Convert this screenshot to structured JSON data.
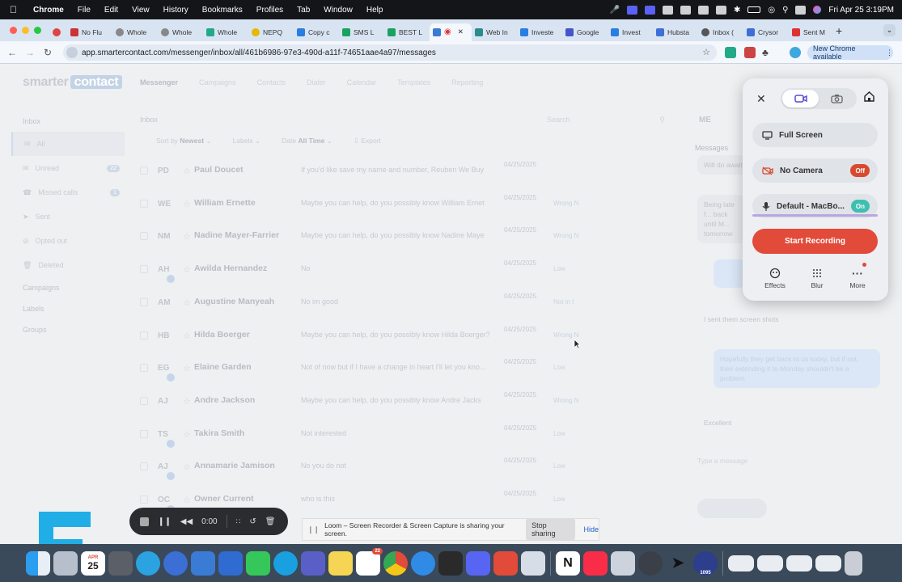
{
  "menubar": {
    "app": "Chrome",
    "items": [
      "File",
      "Edit",
      "View",
      "History",
      "Bookmarks",
      "Profiles",
      "Tab",
      "Window",
      "Help"
    ],
    "clock": "Fri Apr 25  3:19PM"
  },
  "tabs": [
    {
      "label": "",
      "color": "#d44"
    },
    {
      "label": "No Flu",
      "color": "#c33"
    },
    {
      "label": "Whole",
      "color": "#777"
    },
    {
      "label": "Whole",
      "color": "#777"
    },
    {
      "label": "Whole",
      "color": "#2a8"
    },
    {
      "label": "NEPQ",
      "color": "#e6b800"
    },
    {
      "label": "Copy c",
      "color": "#2a7de1"
    },
    {
      "label": "SMS L",
      "color": "#1aa260"
    },
    {
      "label": "BEST L",
      "color": "#1aa260"
    },
    {
      "label": "",
      "color": "#3a7bd5",
      "active": true
    },
    {
      "label": "Web In",
      "color": "#2b8c8c"
    },
    {
      "label": "Investe",
      "color": "#2a7de1"
    },
    {
      "label": "Google",
      "color": "#4455cc"
    },
    {
      "label": "Invest",
      "color": "#2a7de1"
    },
    {
      "label": "Hubsta",
      "color": "#3d6fd6"
    },
    {
      "label": "Inbox (",
      "color": "#555"
    },
    {
      "label": "Crysor",
      "color": "#3d6fd6"
    },
    {
      "label": "Sent M",
      "color": "#d33"
    }
  ],
  "address": {
    "url": "app.smartercontact.com/messenger/inbox/all/461b6986-97e3-490d-a11f-74651aae4a97/messages",
    "new_chrome": "New Chrome available"
  },
  "app": {
    "logo_a": "smarter",
    "logo_b": "contact",
    "nav": [
      "Messenger",
      "Campaigns",
      "Contacts",
      "Dialer",
      "Calendar",
      "Templates",
      "Reporting"
    ],
    "sidebar": {
      "inbox": "Inbox",
      "items": [
        "All",
        "Unread",
        "Missed calls",
        "Sent",
        "Opted out",
        "Deleted"
      ],
      "unread_count": "22",
      "missed_count": "1",
      "sections": [
        "Campaigns",
        "Labels",
        "Groups"
      ]
    },
    "list_title": "Inbox",
    "search_placeholder": "Search",
    "filters": {
      "sort_label": "Sort by",
      "sort_value": "Newest",
      "labels": "Labels",
      "date_label": "Date",
      "date_value": "All Time",
      "export": "Export"
    },
    "rows": [
      {
        "initials": "PD",
        "name": "Paul Doucet",
        "msg": "If you'd like save my name and number, Reuben We Buy",
        "date": "04/25/2025",
        "tag": "",
        "dot": false
      },
      {
        "initials": "WE",
        "name": "William Ernette",
        "msg": "Maybe you can help, do you possibly know William Ernet",
        "date": "04/25/2025",
        "tag": "Wrong N",
        "dot": false
      },
      {
        "initials": "NM",
        "name": "Nadine Mayer-Farrier",
        "msg": "Maybe you can help, do you possibly know Nadine Maye",
        "date": "04/25/2025",
        "tag": "Wrong N",
        "dot": false
      },
      {
        "initials": "AH",
        "name": "Awilda Hernandez",
        "msg": "No",
        "date": "04/25/2025",
        "tag": "Low",
        "dot": true
      },
      {
        "initials": "AM",
        "name": "Augustine Manyeah",
        "msg": "No im good",
        "date": "04/25/2025",
        "tag": "Not in t",
        "dot": false
      },
      {
        "initials": "HB",
        "name": "Hilda Boerger",
        "msg": "Maybe you can help, do you possibly know Hilda Boerger?",
        "date": "04/25/2025",
        "tag": "Wrong N",
        "dot": false
      },
      {
        "initials": "EG",
        "name": "Elaine Garden",
        "msg": "Not of now but if I have a change in heart I'll let you kno...",
        "date": "04/25/2025",
        "tag": "Low",
        "dot": true
      },
      {
        "initials": "AJ",
        "name": "Andre Jackson",
        "msg": "Maybe you can help, do you possibly know Andre Jacks",
        "date": "04/25/2025",
        "tag": "Wrong N",
        "dot": false
      },
      {
        "initials": "TS",
        "name": "Takira Smith",
        "msg": "Not interested",
        "date": "04/25/2025",
        "tag": "Low",
        "dot": true
      },
      {
        "initials": "AJ",
        "name": "Annamarie Jamison",
        "msg": "No you do not",
        "date": "04/25/2025",
        "tag": "Low",
        "dot": true
      },
      {
        "initials": "OC",
        "name": "Owner Current",
        "msg": "who is this",
        "date": "04/25/2025",
        "tag": "Low",
        "dot": true
      }
    ],
    "right": {
      "me": "ME",
      "messages_tab": "Messages",
      "b1": "Will do await",
      "b2": "Being late f... back until M... tomorrow",
      "b3": "I sent them screen shots",
      "b4": "Hopefully they get back to us today, but if not, their extending it to Monday shouldn't be a problem",
      "b5": "Excellent",
      "input_placeholder": "Type a message"
    }
  },
  "loom": {
    "options": [
      {
        "label": "Full Screen",
        "pill": ""
      },
      {
        "label": "No Camera",
        "pill": "Off"
      },
      {
        "label": "Default - MacBo...",
        "pill": "On"
      }
    ],
    "start": "Start Recording",
    "tools": [
      "Effects",
      "Blur",
      "More"
    ],
    "timer": "0:00",
    "share_text": "Loom – Screen Recorder & Screen Capture is sharing your screen.",
    "stop_sharing": "Stop sharing",
    "hide": "Hide"
  },
  "colors": {
    "record": "#e24a3a",
    "on_pill": "#3fbfb0",
    "off_pill": "#d9482f"
  },
  "dock": {
    "calendar_month": "APR",
    "calendar_day": "25",
    "badge_reminders": "22",
    "badge_extra": "1095"
  }
}
